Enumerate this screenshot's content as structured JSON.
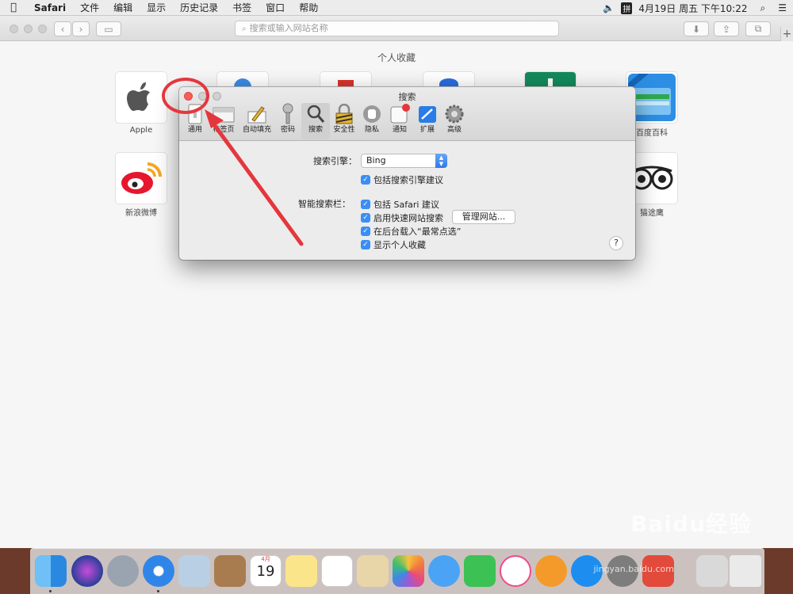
{
  "menubar": {
    "app_name": "Safari",
    "items": [
      "文件",
      "编辑",
      "显示",
      "历史记录",
      "书签",
      "窗口",
      "帮助"
    ],
    "input_method": "拼",
    "datetime": "4月19日 周五 下午10:22"
  },
  "browser": {
    "address_placeholder": "搜索或输入网站名称",
    "favorites_title": "个人收藏",
    "favorites": [
      {
        "label": "Apple",
        "icon": "apple-icon"
      },
      {
        "label": "百度百科",
        "icon": "baidu-baike-icon"
      },
      {
        "label": "新浪微博",
        "icon": "weibo-icon"
      },
      {
        "label": "猫途鹰",
        "icon": "tripadvisor-icon"
      }
    ]
  },
  "prefs": {
    "title": "搜索",
    "tabs": [
      {
        "label": "通用",
        "icon": "general-icon"
      },
      {
        "label": "标签页",
        "icon": "tabs-icon"
      },
      {
        "label": "自动填充",
        "icon": "autofill-icon"
      },
      {
        "label": "密码",
        "icon": "key-icon"
      },
      {
        "label": "搜索",
        "icon": "search-icon"
      },
      {
        "label": "安全性",
        "icon": "lock-icon"
      },
      {
        "label": "隐私",
        "icon": "hand-icon"
      },
      {
        "label": "通知",
        "icon": "notification-icon"
      },
      {
        "label": "扩展",
        "icon": "puzzle-icon"
      },
      {
        "label": "高级",
        "icon": "gear-icon"
      }
    ],
    "active_tab": "搜索",
    "search_engine_label": "搜索引擎：",
    "search_engine_value": "Bing",
    "include_search_suggestions": "包括搜索引擎建议",
    "smart_field_label": "智能搜索栏：",
    "include_safari_suggestions": "包括 Safari 建议",
    "quick_website_search": "启用快速网站搜索",
    "manage_websites_button": "管理网站...",
    "preload_top_hit": "在后台载入“最常点选”",
    "show_favorites": "显示个人收藏",
    "help_symbol": "?"
  },
  "watermark": {
    "brand": "Baidu经验",
    "url": "jingyan.baidu.com"
  },
  "colors": {
    "annotation_red": "#e4373d",
    "checkbox_blue": "#3a8ef6"
  },
  "dock_apps": [
    "finder",
    "siri",
    "launchpad",
    "safari",
    "mail",
    "contacts",
    "calendar",
    "notes",
    "reminders",
    "preview",
    "photos",
    "messages",
    "facetime",
    "itunes",
    "ibooks",
    "app-store",
    "system-preferences",
    "downloads",
    "trash"
  ],
  "calendar_icon": {
    "month": "4月",
    "day": "19"
  }
}
